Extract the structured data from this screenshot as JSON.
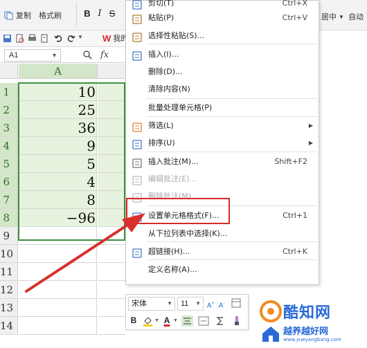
{
  "ribbon": {
    "copy_label": "复制",
    "format_painter_label": "格式刷",
    "bold": "B",
    "italic": "I",
    "strike": "S",
    "center_merge_partial": "居中",
    "partial_right_label": "自动"
  },
  "quickbar": {
    "wps_label": "我的"
  },
  "formula_bar": {
    "name_box": "A1",
    "fx": "fx"
  },
  "grid": {
    "columns": [
      "A"
    ],
    "rows": [
      {
        "row": "1",
        "value": "10"
      },
      {
        "row": "2",
        "value": "25"
      },
      {
        "row": "3",
        "value": "36"
      },
      {
        "row": "4",
        "value": "9"
      },
      {
        "row": "5",
        "value": "5"
      },
      {
        "row": "6",
        "value": "4"
      },
      {
        "row": "7",
        "value": "8"
      },
      {
        "row": "8",
        "value": "−96"
      },
      {
        "row": "9",
        "value": ""
      },
      {
        "row": "10",
        "value": ""
      },
      {
        "row": "11",
        "value": ""
      },
      {
        "row": "12",
        "value": ""
      },
      {
        "row": "13",
        "value": ""
      },
      {
        "row": "14",
        "value": ""
      }
    ]
  },
  "context_menu": {
    "items": [
      {
        "label": "剪切(T)",
        "shortcut": "Ctrl+X",
        "icon": "scissors-icon"
      },
      {
        "label": "粘贴(P)",
        "shortcut": "Ctrl+V",
        "icon": "paste-icon"
      },
      {
        "label": "选择性粘贴(S)...",
        "shortcut": "",
        "icon": "paste-special-icon"
      },
      {
        "label": "插入(I)...",
        "shortcut": "",
        "icon": "insert-icon"
      },
      {
        "label": "删除(D)...",
        "shortcut": "",
        "icon": ""
      },
      {
        "label": "清除内容(N)",
        "shortcut": "",
        "icon": ""
      },
      {
        "label": "批量处理单元格(P)",
        "shortcut": "",
        "icon": ""
      },
      {
        "label": "筛选(L)",
        "shortcut": "",
        "icon": "filter-icon"
      },
      {
        "label": "排序(U)",
        "shortcut": "",
        "icon": "sort-icon"
      },
      {
        "label": "插入批注(M)...",
        "shortcut": "Shift+F2",
        "icon": "comment-icon"
      },
      {
        "label": "编辑批注(E)...",
        "shortcut": "",
        "icon": "edit-comment-icon"
      },
      {
        "label": "删除批注(M)",
        "shortcut": "",
        "icon": "delete-comment-icon"
      },
      {
        "label": "设置单元格格式(F)...",
        "shortcut": "Ctrl+1",
        "icon": "format-cells-icon"
      },
      {
        "label": "从下拉列表中选择(K)...",
        "shortcut": "",
        "icon": ""
      },
      {
        "label": "超链接(H)...",
        "shortcut": "Ctrl+K",
        "icon": "hyperlink-icon"
      },
      {
        "label": "定义名称(A)...",
        "shortcut": "",
        "icon": ""
      }
    ]
  },
  "mini_toolbar": {
    "font_name": "宋体",
    "font_size": "11",
    "bold": "B",
    "font_color": "A"
  },
  "watermark": {
    "line1": "酷知网",
    "line2": "越养越好网",
    "url": "www.yueyangbang.com"
  },
  "colors": {
    "selection_fill": "#e7f3de",
    "selection_border": "#3f8f3f",
    "highlight_box": "#d42a2a",
    "arrow": "#d9302c",
    "watermark": "#2a6bd6"
  }
}
